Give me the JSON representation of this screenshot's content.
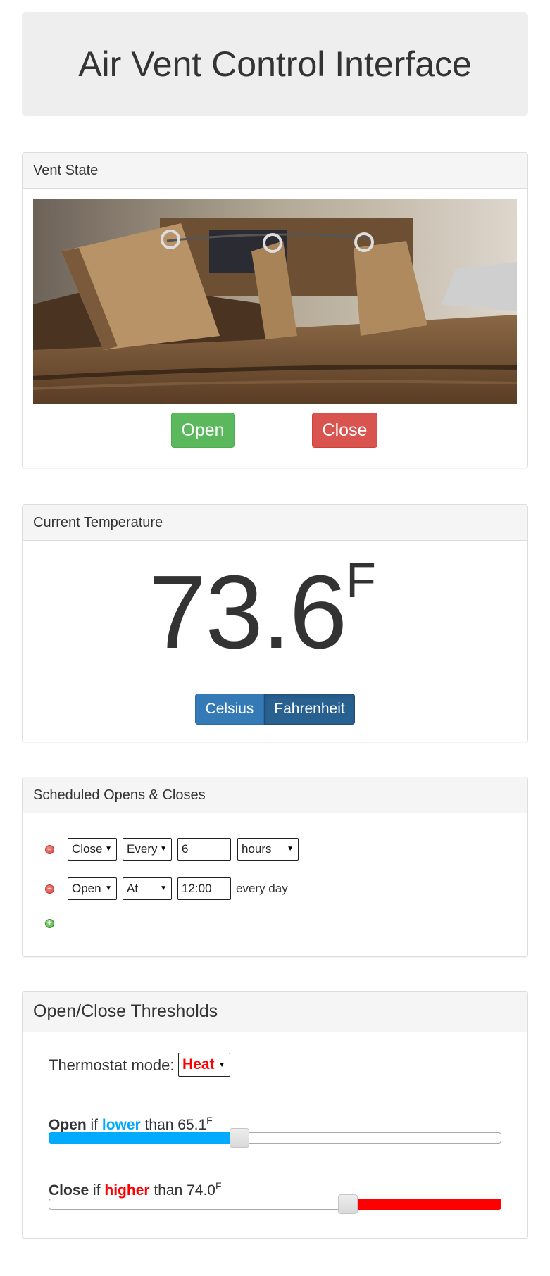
{
  "header": {
    "title": "Air Vent Control Interface"
  },
  "vent_state": {
    "heading": "Vent State",
    "open_label": "Open",
    "close_label": "Close"
  },
  "temperature": {
    "heading": "Current Temperature",
    "value": "73.6",
    "unit": "F",
    "celsius_label": "Celsius",
    "fahrenheit_label": "Fahrenheit"
  },
  "schedule": {
    "heading": "Scheduled Opens & Closes",
    "rows": [
      {
        "action": "Close",
        "mode": "Every",
        "value": "6",
        "unit": "hours"
      },
      {
        "action": "Open",
        "mode": "At",
        "value": "12:00",
        "suffix": "every day"
      }
    ]
  },
  "thresholds": {
    "heading": "Open/Close Thresholds",
    "mode_label": "Thermostat mode:",
    "mode_value": "Heat",
    "open": {
      "word": "Open",
      "if": "if",
      "cmp": "lower",
      "than": "than",
      "value": "65.1",
      "unit": "F",
      "level": 0.42
    },
    "close": {
      "word": "Close",
      "if": "if",
      "cmp": "higher",
      "than": "than",
      "value": "74.0",
      "unit": "F",
      "level": 0.66
    }
  },
  "colors": {
    "open_button": "#5cb85c",
    "close_button": "#d9534f",
    "lower": "#00aaff",
    "higher": "#ff0000"
  }
}
